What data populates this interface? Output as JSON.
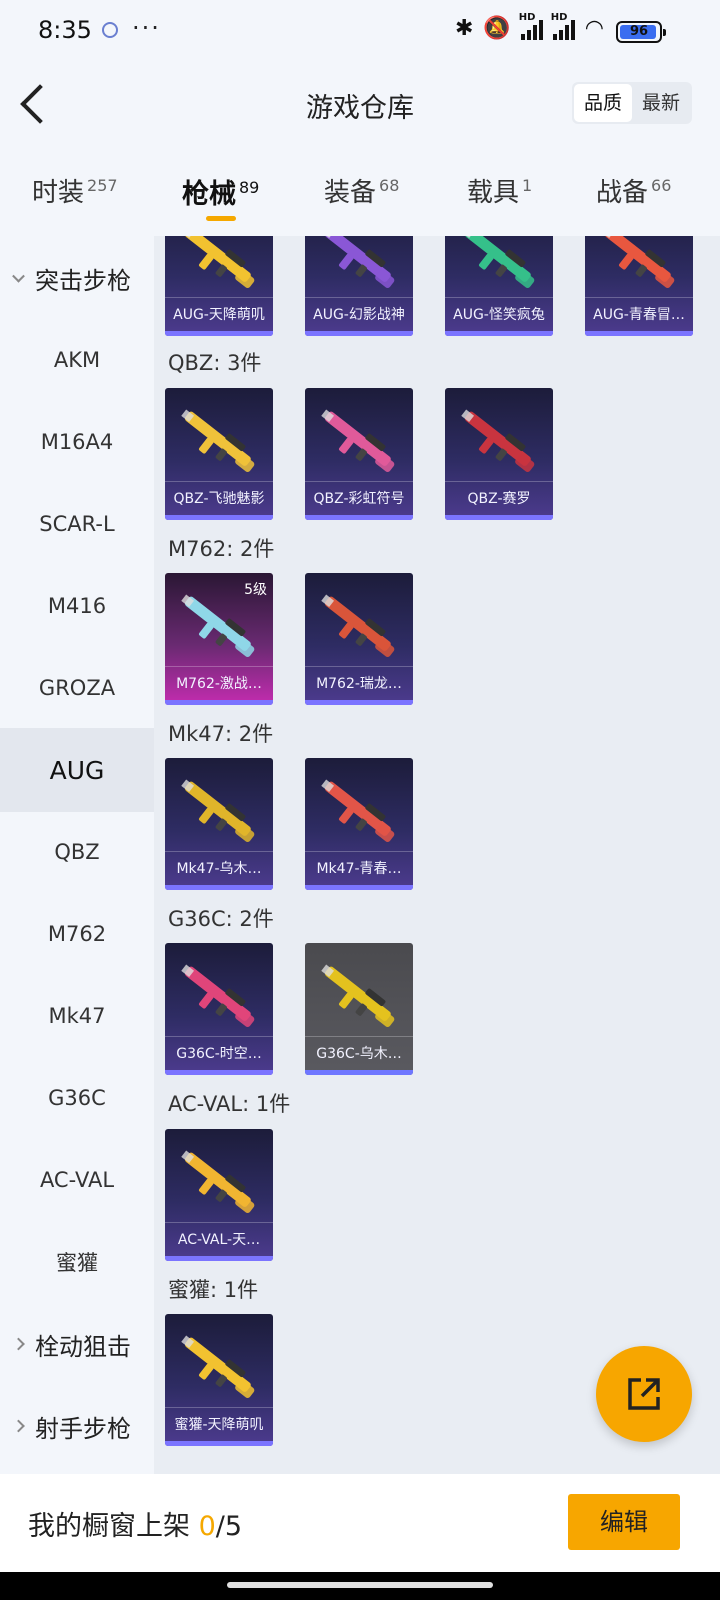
{
  "status": {
    "time": "8:35",
    "more": "···",
    "battery": "96",
    "hd": "HD"
  },
  "header": {
    "title": "游戏仓库",
    "sort_options": [
      "品质",
      "最新"
    ],
    "sort_active": "品质"
  },
  "tabs": [
    {
      "label": "时装",
      "count": "257"
    },
    {
      "label": "枪械",
      "count": "89"
    },
    {
      "label": "装备",
      "count": "68"
    },
    {
      "label": "载具",
      "count": "1"
    },
    {
      "label": "战备",
      "count": "66"
    }
  ],
  "sidebar": {
    "groups": [
      {
        "label": "突击步枪",
        "items": [
          "AKM",
          "M16A4",
          "SCAR-L",
          "M416",
          "GROZA",
          "AUG",
          "QBZ",
          "M762",
          "Mk47",
          "G36C",
          "AC-VAL",
          "蜜獾"
        ],
        "active": "AUG"
      },
      {
        "label": "栓动狙击"
      },
      {
        "label": "射手步枪"
      }
    ]
  },
  "sections": [
    {
      "label": "",
      "cards": [
        {
          "name": "AUG-天降萌叽",
          "color": "#f2c230"
        },
        {
          "name": "AUG-幻影战神",
          "color": "#8a57d6"
        },
        {
          "name": "AUG-怪笑疯兔",
          "color": "#35c08a"
        },
        {
          "name": "AUG-青春冒…",
          "color": "#e8573f"
        }
      ]
    },
    {
      "label": "QBZ: 3件",
      "cards": [
        {
          "name": "QBZ-飞驰魅影",
          "color": "#f0c23a"
        },
        {
          "name": "QBZ-彩虹符号",
          "color": "#e05a9a"
        },
        {
          "name": "QBZ-赛罗",
          "color": "#c9343f"
        }
      ]
    },
    {
      "label": "M762: 2件",
      "cards": [
        {
          "name": "M762-激战…",
          "color": "#8fd7e8",
          "level": "5级",
          "style": "purple"
        },
        {
          "name": "M762-瑞龙…",
          "color": "#d9553a"
        }
      ]
    },
    {
      "label": "Mk47: 2件",
      "cards": [
        {
          "name": "Mk47-乌木…",
          "color": "#e0b52a"
        },
        {
          "name": "Mk47-青春…",
          "color": "#e25548"
        }
      ]
    },
    {
      "label": "G36C: 2件",
      "cards": [
        {
          "name": "G36C-时空…",
          "color": "#e0457a"
        },
        {
          "name": "G36C-乌木…",
          "color": "#e4c21e",
          "style": "gray"
        }
      ]
    },
    {
      "label": "AC-VAL: 1件",
      "cards": [
        {
          "name": "AC-VAL-天…",
          "color": "#f1b531"
        }
      ]
    },
    {
      "label": "蜜獾: 1件",
      "cards": [
        {
          "name": "蜜獾-天降萌叽",
          "color": "#f2c230"
        }
      ]
    }
  ],
  "bottom": {
    "prefix": "我的橱窗上架 ",
    "count": "0",
    "total": "/5",
    "edit_label": "编辑"
  },
  "colors": {
    "accent": "#f7a600",
    "card_bar": "#7b74ff"
  },
  "icons": {
    "fab": "share-icon",
    "back": "back-arrow-icon"
  }
}
